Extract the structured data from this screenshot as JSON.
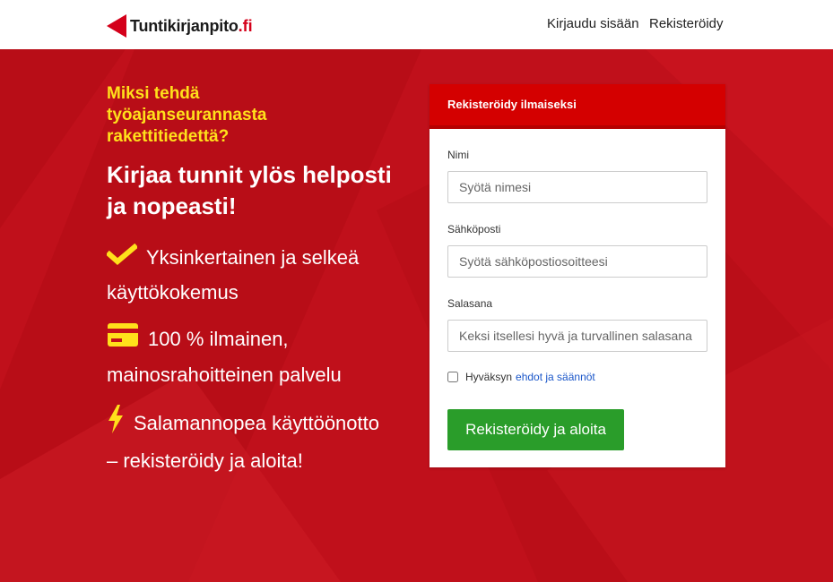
{
  "header": {
    "logo_text": "Tuntikirjanpito",
    "logo_suffix": ".fi",
    "nav_login": "Kirjaudu sisään",
    "nav_register": "Rekisteröidy"
  },
  "hero": {
    "tagline": "Miksi tehdä työajanseurannasta rakettitiedettä?",
    "headline": "Kirjaa tunnit ylös helposti ja nopeasti!",
    "features": [
      {
        "icon": "check-icon",
        "text": "Yksinkertainen ja selkeä käyttökokemus"
      },
      {
        "icon": "credit-card-icon",
        "text": "100 % ilmainen, mainosrahoitteinen palvelu"
      },
      {
        "icon": "lightning-icon",
        "text": "Salamannopea käyttöönotto – rekisteröidy ja aloita!"
      }
    ]
  },
  "form": {
    "title": "Rekisteröidy ilmaiseksi",
    "name_label": "Nimi",
    "name_placeholder": "Syötä nimesi",
    "email_label": "Sähköposti",
    "email_placeholder": "Syötä sähköpostiosoitteesi",
    "password_label": "Salasana",
    "password_placeholder": "Keksi itsellesi hyvä ja turvallinen salasana",
    "terms_text": "Hyväksyn",
    "terms_link": "ehdot ja säännöt",
    "terms_checked": false,
    "submit_label": "Rekisteröidy ja aloita"
  },
  "colors": {
    "brand_red": "#c20e19",
    "accent_yellow": "#ffe01b",
    "submit_green": "#2a9d2a",
    "link_blue": "#1a56c9"
  }
}
